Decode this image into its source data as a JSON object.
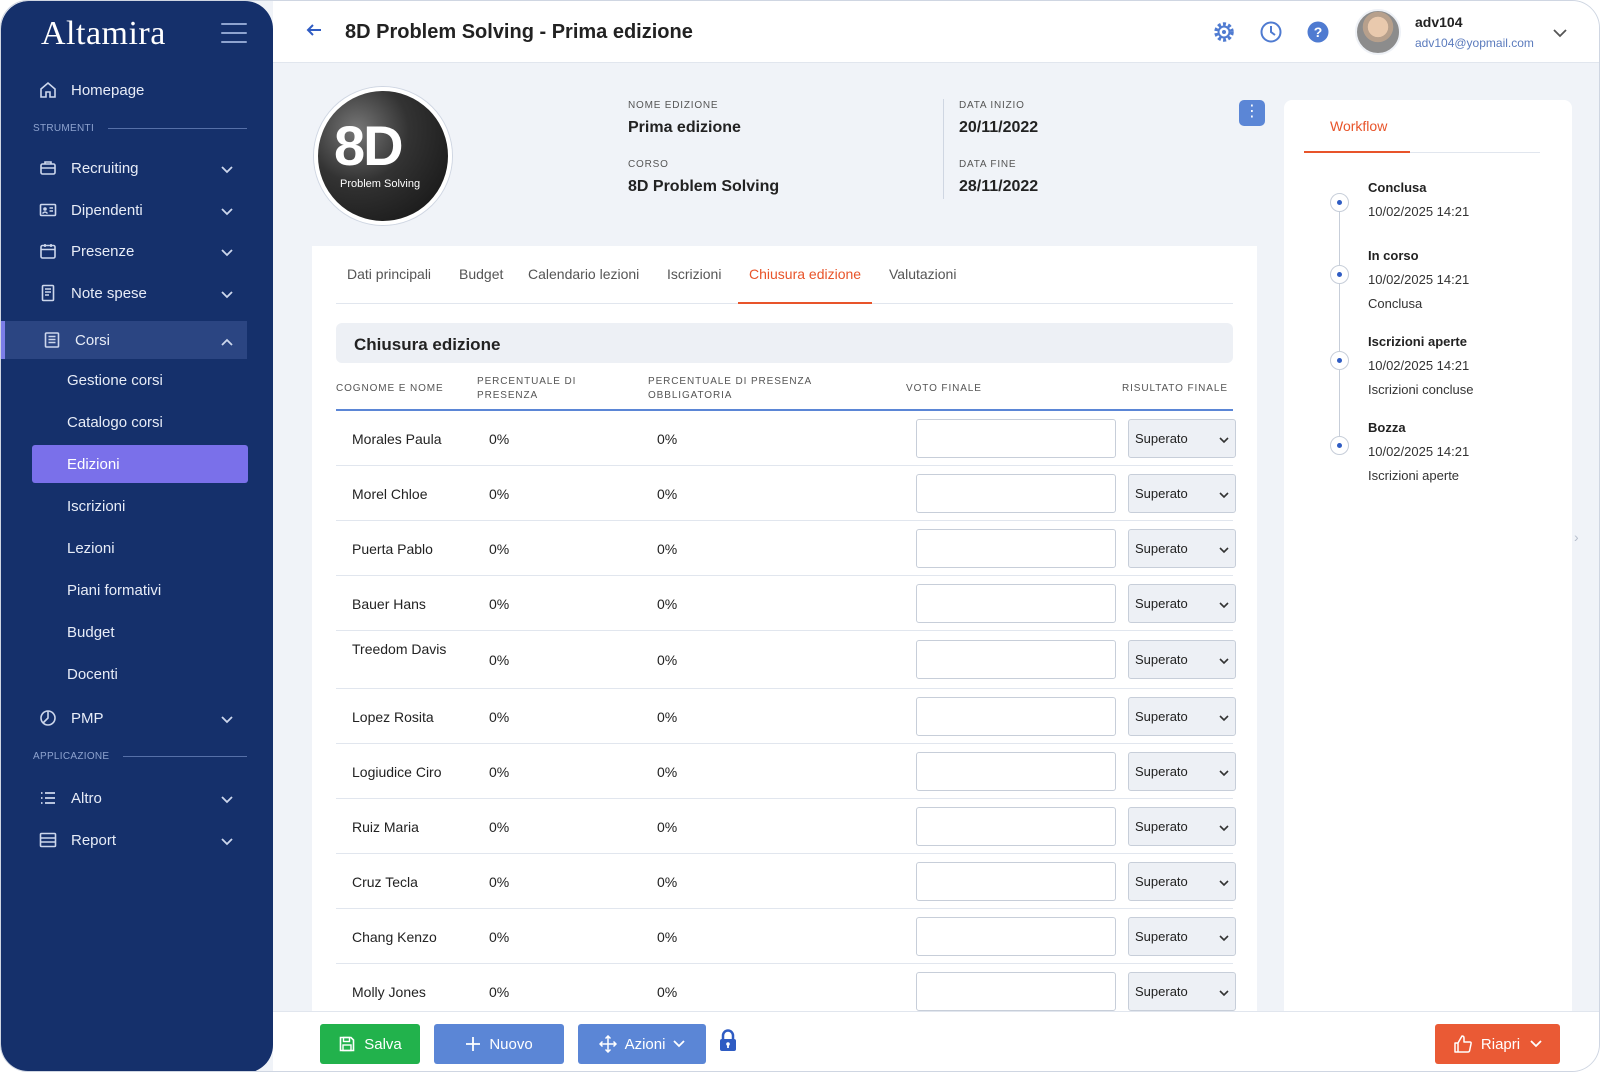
{
  "app": {
    "brand": "Altamira"
  },
  "sidebar": {
    "items": [
      {
        "label": "Homepage"
      },
      {
        "label": "Recruiting"
      },
      {
        "label": "Dipendenti"
      },
      {
        "label": "Presenze"
      },
      {
        "label": "Note spese"
      },
      {
        "label": "Corsi"
      },
      {
        "label": "PMP"
      },
      {
        "label": "Altro"
      },
      {
        "label": "Report"
      }
    ],
    "sections": {
      "strumenti": "STRUMENTI",
      "applicazione": "APPLICAZIONE"
    },
    "corsi_sub": [
      "Gestione corsi",
      "Catalogo corsi",
      "Edizioni",
      "Iscrizioni",
      "Lezioni",
      "Piani formativi",
      "Budget",
      "Docenti"
    ],
    "selected_sub": "Edizioni"
  },
  "header": {
    "title": "8D Problem Solving - Prima edizione",
    "user": {
      "name": "adv104",
      "email": "adv104@yopmail.com"
    }
  },
  "course": {
    "image_text": "8D",
    "image_subtext": "Problem Solving",
    "nome_edizione_label": "NOME EDIZIONE",
    "nome_edizione": "Prima edizione",
    "corso_label": "CORSO",
    "corso": "8D Problem Solving",
    "data_inizio_label": "DATA INIZIO",
    "data_inizio": "20/11/2022",
    "data_fine_label": "DATA FINE",
    "data_fine": "28/11/2022"
  },
  "tabs": [
    "Dati principali",
    "Budget",
    "Calendario lezioni",
    "Iscrizioni",
    "Chiusura edizione",
    "Valutazioni"
  ],
  "active_tab": "Chiusura edizione",
  "section_title": "Chiusura edizione",
  "table": {
    "headers": {
      "name": "COGNOME E NOME",
      "presence_1": "PERCENTUALE DI",
      "presence_2": "PRESENZA",
      "required_1": "PERCENTUALE DI PRESENZA",
      "required_2": "OBBLIGATORIA",
      "grade": "VOTO FINALE",
      "result": "RISULTATO FINALE"
    },
    "rows": [
      {
        "name": "Morales Paula",
        "presence": "0%",
        "required": "0%",
        "grade": "",
        "result": "Superato"
      },
      {
        "name": "Morel Chloe",
        "presence": "0%",
        "required": "0%",
        "grade": "",
        "result": "Superato"
      },
      {
        "name": "Puerta Pablo",
        "presence": "0%",
        "required": "0%",
        "grade": "",
        "result": "Superato"
      },
      {
        "name": "Bauer Hans",
        "presence": "0%",
        "required": "0%",
        "grade": "",
        "result": "Superato"
      },
      {
        "name": "Treedom Davis",
        "presence": "0%",
        "required": "0%",
        "grade": "",
        "result": "Superato"
      },
      {
        "name": "Lopez Rosita",
        "presence": "0%",
        "required": "0%",
        "grade": "",
        "result": "Superato"
      },
      {
        "name": "Logiudice Ciro",
        "presence": "0%",
        "required": "0%",
        "grade": "",
        "result": "Superato"
      },
      {
        "name": "Ruiz Maria",
        "presence": "0%",
        "required": "0%",
        "grade": "",
        "result": "Superato"
      },
      {
        "name": "Cruz Tecla",
        "presence": "0%",
        "required": "0%",
        "grade": "",
        "result": "Superato"
      },
      {
        "name": "Chang Kenzo",
        "presence": "0%",
        "required": "0%",
        "grade": "",
        "result": "Superato"
      },
      {
        "name": "Molly Jones",
        "presence": "0%",
        "required": "0%",
        "grade": "",
        "result": "Superato"
      }
    ]
  },
  "workflow": {
    "tab": "Workflow",
    "steps": [
      {
        "title": "Conclusa",
        "date": "10/02/2025 14:21",
        "next": ""
      },
      {
        "title": "In corso",
        "date": "10/02/2025 14:21",
        "next": "Conclusa"
      },
      {
        "title": "Iscrizioni aperte",
        "date": "10/02/2025 14:21",
        "next": "Iscrizioni concluse"
      },
      {
        "title": "Bozza",
        "date": "10/02/2025 14:21",
        "next": "Iscrizioni aperte"
      }
    ]
  },
  "bottombar": {
    "save": "Salva",
    "new": "Nuovo",
    "actions": "Azioni",
    "reopen": "Riapri"
  },
  "colors": {
    "sidebar": "#15306b",
    "accent": "#e8542a",
    "selected": "#7a70ea",
    "save": "#22b24c",
    "primary": "#5b86d6",
    "reopen": "#ea5a35"
  }
}
